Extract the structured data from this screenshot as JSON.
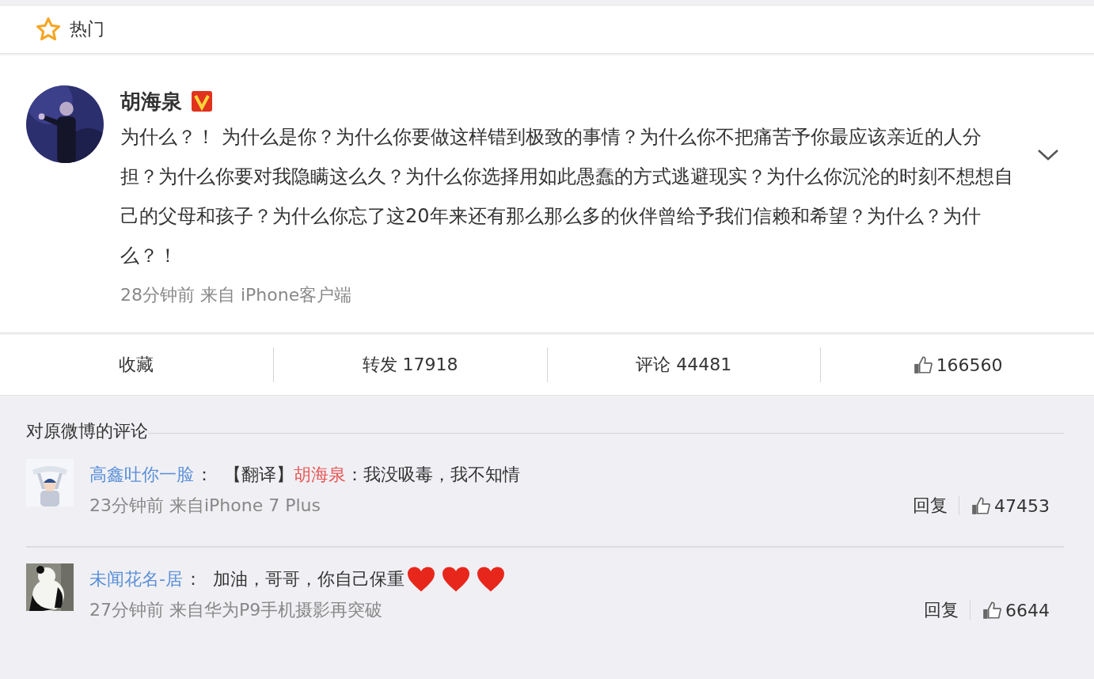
{
  "header": {
    "title": "热门"
  },
  "post": {
    "author": "胡海泉",
    "verified": true,
    "avatar": {
      "kind": "picture"
    },
    "text": "为什么？！ 为什么是你？为什么你要做这样错到极致的事情？为什么你不把痛苦予你最应该亲近的人分担？为什么你要对我隐瞒这么久？为什么你选择用如此愚蠢的方式逃避现实？为什么你沉沦的时刻不想想自己的父母和孩子？为什么你忘了这20年来还有那么那么多的伙伴曾给予我们信赖和希望？为什么？为什么？！",
    "meta": "28分钟前 来自 iPhone客户端"
  },
  "actions": [
    {
      "kind": "favorite",
      "label": "收藏"
    },
    {
      "kind": "repost",
      "label": "转发 17918"
    },
    {
      "kind": "comment",
      "label": "评论 44481"
    },
    {
      "kind": "like",
      "label": "166560"
    }
  ],
  "comments_section": {
    "title": "对原微博的评论"
  },
  "comments": [
    {
      "avatar": {
        "kind": "picture"
      },
      "user": "高鑫吐你一脸",
      "separator": "：",
      "prefix": "【翻译】",
      "mention": "胡海泉",
      "text": "：我没吸毒，我不知情",
      "meta": "23分钟前 来自iPhone 7 Plus",
      "reply": "回复",
      "likes": "47453"
    },
    {
      "avatar": {
        "kind": "picture"
      },
      "user": "未闻花名-居",
      "separator": "：",
      "text": "加油，哥哥，你自己保重",
      "emojis": [
        {
          "kind": "heart"
        },
        {
          "kind": "heart"
        },
        {
          "kind": "heart"
        }
      ],
      "meta": "27分钟前 来自华为P9手机摄影再突破",
      "reply": "回复",
      "likes": "6644"
    }
  ]
}
